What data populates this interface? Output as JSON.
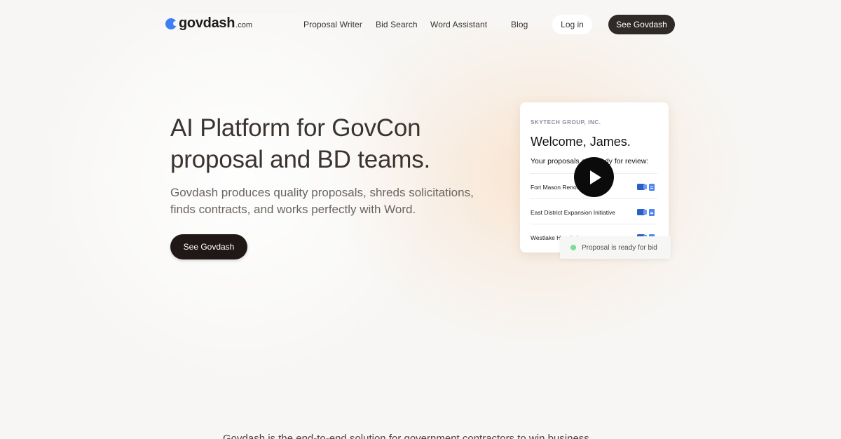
{
  "nav": {
    "logo_word": "govdash",
    "logo_tld": ".com",
    "links": [
      "Proposal Writer",
      "Bid Search",
      "Word Assistant",
      "Blog"
    ],
    "login_label": "Log in",
    "cta_label": "See Govdash"
  },
  "hero": {
    "title": "AI Platform for GovCon proposal and BD teams.",
    "subtitle": "Govdash produces quality proposals, shreds solicitations, finds contracts, and works perfectly with Word.",
    "cta_label": "See Govdash"
  },
  "card": {
    "company": "SKYTECH GROUP, INC.",
    "welcome": "Welcome, James.",
    "review_text": "Your proposals are ready for review:",
    "rows": [
      {
        "name": "Fort Mason Renovation"
      },
      {
        "name": "East District Expansion Initiative"
      },
      {
        "name": "Westlake Hospital"
      }
    ]
  },
  "toast": {
    "text": "Proposal is ready for bid"
  },
  "colors": {
    "accent": "#3f7ef5",
    "dark_button": "#1f1816",
    "status_green": "#7ddc9a"
  },
  "bottom": {
    "text": "Govdash is the end-to-end solution for government contractors to win business."
  }
}
